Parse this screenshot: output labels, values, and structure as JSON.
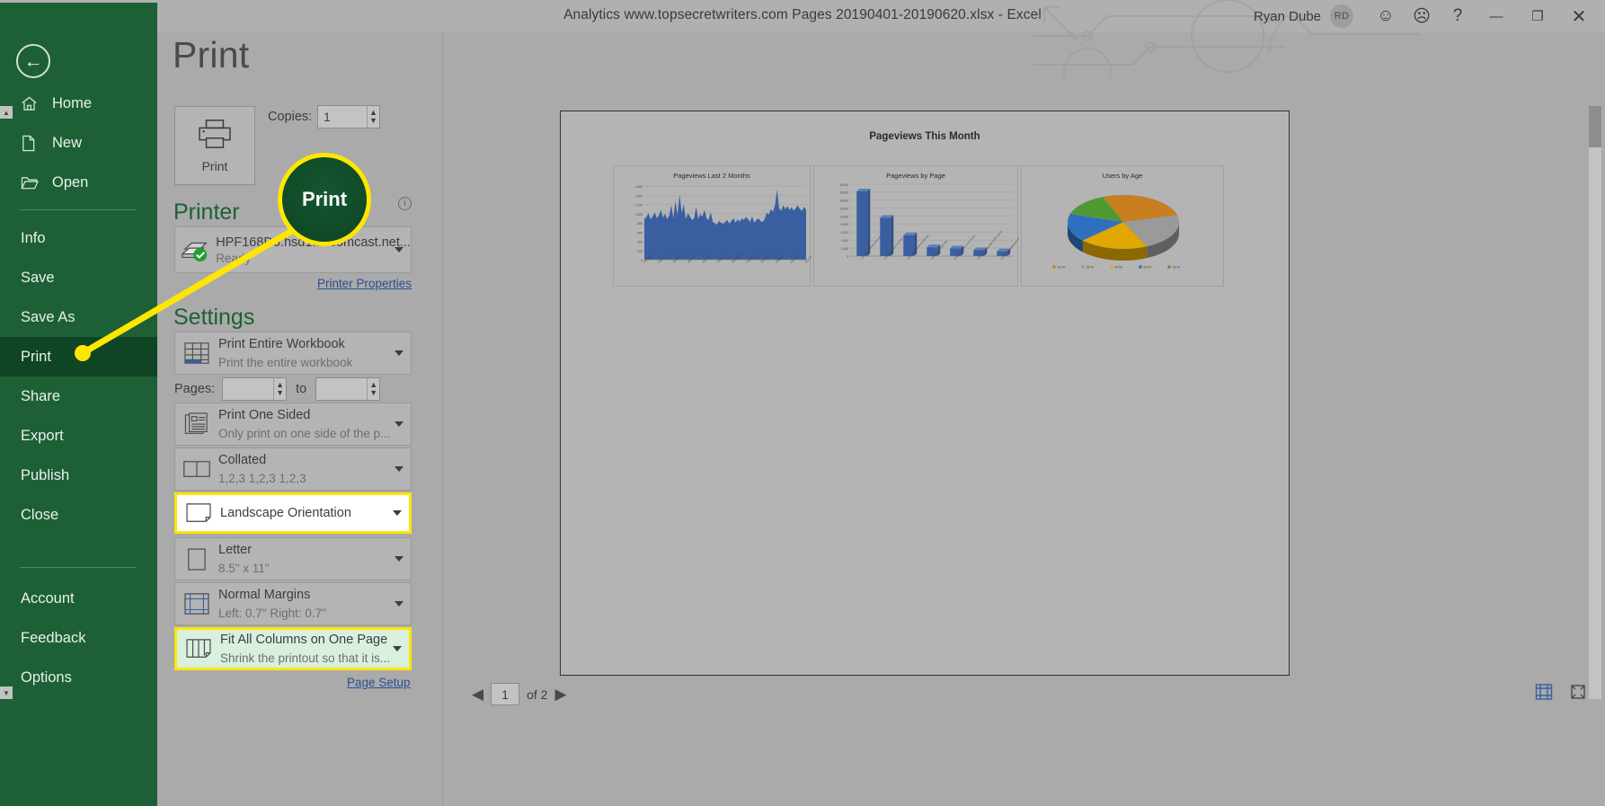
{
  "window": {
    "title": "Analytics www.topsecretwriters.com Pages 20190401-20190620.xlsx  -  Excel",
    "user_name": "Ryan Dube",
    "avatar_initials": "RD",
    "smile_icon": "☺",
    "frown_icon": "☹",
    "help_icon": "?",
    "minimize_icon": "—",
    "restore_icon": "❐",
    "close_icon": "✕",
    "accent_color": "#1d6036"
  },
  "nav": {
    "back_icon": "←",
    "items": [
      {
        "label": "Home",
        "icon": "home-icon",
        "selected": false
      },
      {
        "label": "New",
        "icon": "new-document-icon",
        "selected": false
      },
      {
        "label": "Open",
        "icon": "open-folder-icon",
        "selected": false
      },
      {
        "label": "Info",
        "icon": "",
        "selected": false
      },
      {
        "label": "Save",
        "icon": "",
        "selected": false
      },
      {
        "label": "Save As",
        "icon": "",
        "selected": false
      },
      {
        "label": "Print",
        "icon": "",
        "selected": true
      },
      {
        "label": "Share",
        "icon": "",
        "selected": false
      },
      {
        "label": "Export",
        "icon": "",
        "selected": false
      },
      {
        "label": "Publish",
        "icon": "",
        "selected": false
      },
      {
        "label": "Close",
        "icon": "",
        "selected": false
      },
      {
        "label": "Account",
        "icon": "",
        "selected": false
      },
      {
        "label": "Feedback",
        "icon": "",
        "selected": false
      },
      {
        "label": "Options",
        "icon": "",
        "selected": false
      }
    ]
  },
  "backstage": {
    "page_title": "Print",
    "print_button_label": "Print",
    "copies_label": "Copies:",
    "copies_value": "1",
    "printer_heading": "Printer",
    "printer_name": "HPF168D6.hsd1.in.comcast.net...",
    "printer_status": "Ready",
    "printer_properties_link": "Printer Properties",
    "settings_heading": "Settings",
    "pages_label": "Pages:",
    "pages_from": "",
    "pages_to_label": "to",
    "pages_to": "",
    "page_setup_link": "Page Setup",
    "options": [
      {
        "name": "print-range",
        "title": "Print Entire Workbook",
        "subtitle": "Print the entire workbook",
        "icon": "workbook-grid-icon",
        "highlight": "none"
      },
      {
        "name": "print-sides",
        "title": "Print One Sided",
        "subtitle": "Only print on one side of the p...",
        "icon": "one-sided-page-icon",
        "highlight": "none"
      },
      {
        "name": "collation",
        "title": "Collated",
        "subtitle": "1,2,3   1,2,3   1,2,3",
        "icon": "collated-pages-icon",
        "highlight": "none"
      },
      {
        "name": "orientation",
        "title": "Landscape Orientation",
        "subtitle": "",
        "icon": "landscape-page-icon",
        "highlight": "white"
      },
      {
        "name": "paper-size",
        "title": "Letter",
        "subtitle": "8.5\" x 11\"",
        "icon": "paper-size-icon",
        "highlight": "none"
      },
      {
        "name": "margins",
        "title": "Normal Margins",
        "subtitle": "Left:  0.7\"   Right:  0.7\"",
        "icon": "margins-icon",
        "highlight": "none"
      },
      {
        "name": "scaling",
        "title": "Fit All Columns on One Page",
        "subtitle": "Shrink the printout so that it is...",
        "icon": "fit-columns-icon",
        "highlight": "green"
      }
    ]
  },
  "preview": {
    "sheet_title": "Pageviews This Month",
    "page_current": "1",
    "page_of_label": "of 2",
    "prev_arrow": "◀",
    "next_arrow": "▶",
    "margins_toggle_icon": "show-margins-icon",
    "zoom_to_page_icon": "zoom-to-page-icon"
  },
  "callout": {
    "label": "Print",
    "highlight_color": "#ffe600",
    "button_color": "#0d4524"
  },
  "chart_data": [
    {
      "type": "area",
      "title": "Pageviews Last 2 Months",
      "xlabel": "",
      "ylabel": "",
      "ylim": [
        0,
        1600
      ],
      "yticks": [
        0,
        200,
        400,
        600,
        800,
        1000,
        1200,
        1400,
        1600
      ],
      "grid": true,
      "legend": false,
      "series_color": "#3a5fa0",
      "tick_labels": [
        "4/1/2019",
        "4/8/2019",
        "4/15/2019",
        "4/22/2019",
        "4/29/2019",
        "5/6/2019",
        "5/13/2019",
        "5/20/2019",
        "5/27/2019",
        "6/3/2019",
        "6/10/2019",
        "6/17/2019"
      ],
      "values": [
        880,
        930,
        1010,
        870,
        940,
        1030,
        900,
        960,
        1080,
        910,
        1000,
        880,
        960,
        1180,
        900,
        1280,
        960,
        1420,
        1020,
        1200,
        880,
        1010,
        940,
        860,
        900,
        1150,
        880,
        990,
        940,
        1080,
        900,
        860,
        1030,
        820,
        790,
        760,
        840,
        800,
        780,
        820,
        860,
        780,
        840,
        900,
        800,
        880,
        820,
        900,
        860,
        930,
        880,
        820,
        940,
        800,
        860,
        900,
        840,
        820,
        880,
        1020,
        980,
        1100,
        1040,
        1180,
        1520,
        1120,
        1060,
        1180,
        1100,
        1160,
        1080,
        1140,
        1060,
        1120,
        1180,
        1100,
        1060,
        1150,
        1080
      ]
    },
    {
      "type": "bar",
      "title": "Pageviews by Page",
      "xlabel": "",
      "ylabel": "",
      "ylim": [
        0,
        18000
      ],
      "yticks": [
        0,
        2000,
        4000,
        6000,
        8000,
        10000,
        12000,
        14000,
        16000,
        18000
      ],
      "grid": true,
      "legend": false,
      "series_color": "#3a5fa0",
      "categories": [
        "2019/04/secret-government",
        "2019/05/area-51-mystery",
        "2019/05/government-drones",
        "2019/05/ufo-sightings",
        "2019/06/aliens-on-the-moon",
        "2019/06/declassified-1970-secret",
        "2019/06/strangest-places-in-the-world"
      ],
      "values": [
        16200,
        9600,
        5200,
        2200,
        1900,
        1500,
        1200
      ]
    },
    {
      "type": "pie",
      "title": "Users by Age",
      "grid": false,
      "legend": true,
      "legend_position": "bottom",
      "labels": [
        "25-34",
        "35-44",
        "45-54",
        "55-64",
        "18-24"
      ],
      "values": [
        27,
        22,
        20,
        17,
        14
      ],
      "colors": [
        "#c87f20",
        "#9a9a9a",
        "#e0a800",
        "#2f6fbf",
        "#4e9a30"
      ]
    }
  ]
}
